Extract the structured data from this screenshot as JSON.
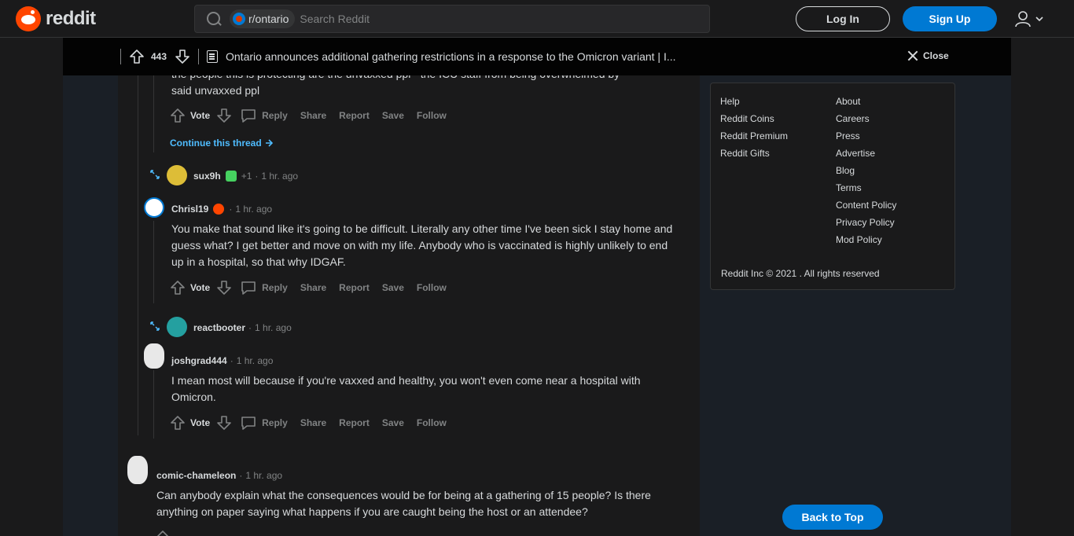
{
  "header": {
    "logo_text": "reddit",
    "subreddit_chip": "r/ontario",
    "search_placeholder": "Search Reddit",
    "login_label": "Log In",
    "signup_label": "Sign Up"
  },
  "post_bar": {
    "vote_count": "443",
    "title": "Ontario announces additional gathering restrictions in a response to the Omicron variant | I...",
    "close_label": "Close"
  },
  "comments": {
    "c0": {
      "text_line1": "the people this is protecting are the unvaxxed ppl - the ICU staff from being overwhelmed by",
      "text_line2": "said unvaxxed ppl",
      "vote_label": "Vote"
    },
    "continue_label": "Continue this thread",
    "c1": {
      "user": "sux9h",
      "extra": "+1",
      "dot": "·",
      "time": "1 hr. ago"
    },
    "c2": {
      "user": "Chrisl19",
      "dot": "·",
      "time": "1 hr. ago",
      "text": "You make that sound like it's going to be difficult. Literally any other time I've been sick I stay home and guess what? I get better and move on with my life. Anybody who is vaccinated is highly unlikely to end up in a hospital, so that why IDGAF.",
      "vote_label": "Vote"
    },
    "c3": {
      "user": "reactbooter",
      "dot": "·",
      "time": "1 hr. ago"
    },
    "c4": {
      "user": "joshgrad444",
      "dot": "·",
      "time": "1 hr. ago",
      "text": "I mean most will because if you're vaxxed and healthy, you won't even come near a hospital with Omicron.",
      "vote_label": "Vote"
    },
    "c5": {
      "user": "comic-chameleon",
      "dot": "·",
      "time": "1 hr. ago",
      "text": "Can anybody explain what the consequences would be for being at a gathering of 15 people? Is there anything on paper saying what happens if you are caught being the host or an attendee?"
    },
    "actions": {
      "reply": "Reply",
      "share": "Share",
      "report": "Report",
      "save": "Save",
      "follow": "Follow"
    }
  },
  "sidebar": {
    "col1": [
      "Help",
      "Reddit Coins",
      "Reddit Premium",
      "Reddit Gifts"
    ],
    "col2": [
      "About",
      "Careers",
      "Press",
      "Advertise",
      "Blog",
      "Terms",
      "Content Policy",
      "Privacy Policy",
      "Mod Policy"
    ],
    "copyright": "Reddit Inc © 2021 . All rights reserved"
  },
  "back_to_top": "Back to Top",
  "colors": {
    "brand": "#ff4500",
    "accent_blue": "#0079d3",
    "link_blue": "#4fbcff"
  }
}
